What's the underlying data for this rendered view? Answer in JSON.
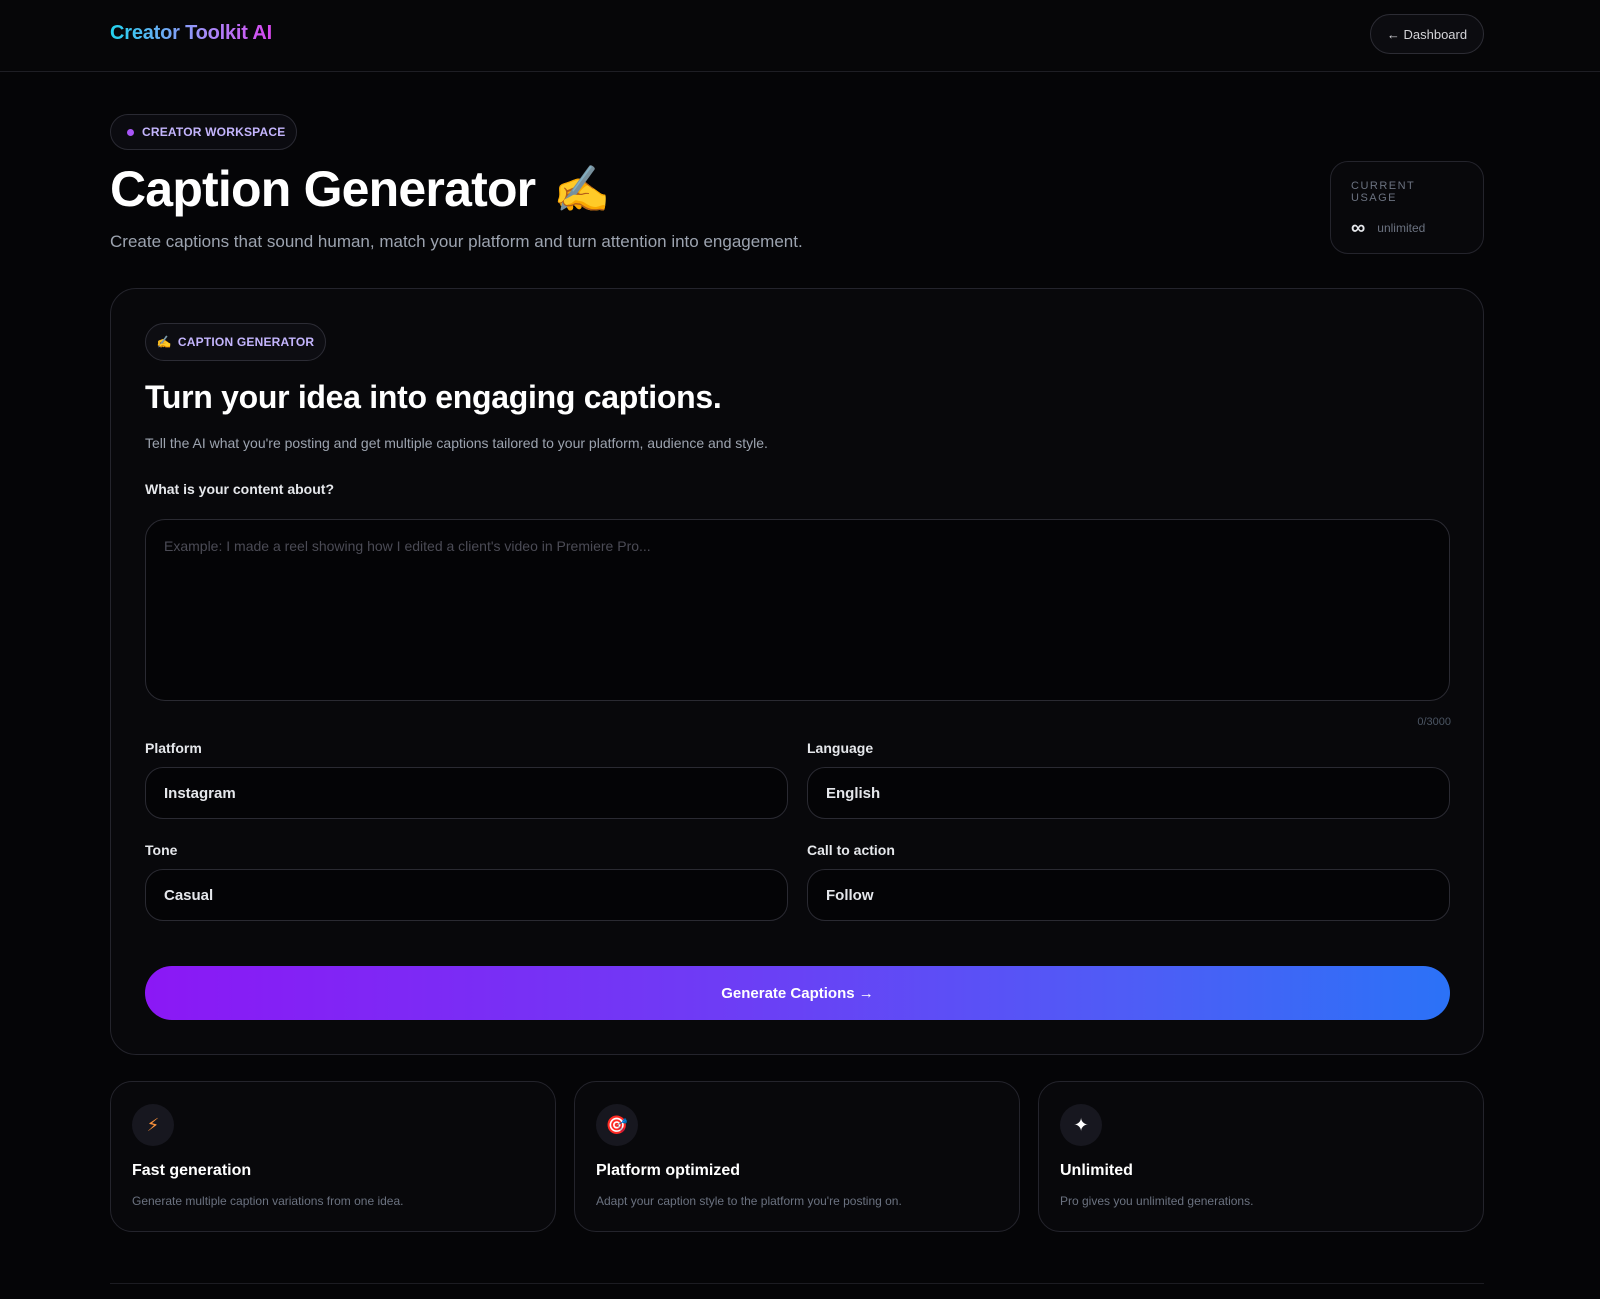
{
  "header": {
    "brand": "Creator Toolkit AI",
    "dashboard_button": "← Dashboard"
  },
  "hero": {
    "badge": "CREATOR WORKSPACE",
    "title": "Caption Generator",
    "title_emoji": "✍️",
    "subtitle": "Create captions that sound human, match your platform and turn attention into engagement."
  },
  "usage": {
    "label": "CURRENT USAGE",
    "icon": "∞",
    "value": "unlimited"
  },
  "card": {
    "badge_emoji": "✍️",
    "badge": "CAPTION GENERATOR",
    "title": "Turn your idea into engaging captions.",
    "subtitle": "Tell the AI what you're posting and get multiple captions tailored to your platform, audience and style.",
    "content_label": "What is your content about?",
    "content_value": "",
    "content_placeholder": "Example: I made a reel showing how I edited a client's video in Premiere Pro...",
    "counter": "0/3000",
    "platform_label": "Platform",
    "platform_value": "Instagram",
    "language_label": "Language",
    "language_value": "English",
    "tone_label": "Tone",
    "tone_value": "Casual",
    "cta_label": "Call to action",
    "cta_value": "Follow",
    "generate_button": "Generate Captions →"
  },
  "features": [
    {
      "icon": "⚡",
      "icon_name": "lightning-icon",
      "title": "Fast generation",
      "description": "Generate multiple caption variations from one idea."
    },
    {
      "icon": "🎯",
      "icon_name": "target-icon",
      "title": "Platform optimized",
      "description": "Adapt your caption style to the platform you're posting on."
    },
    {
      "icon": "✦",
      "icon_name": "sparkle-icon",
      "title": "Unlimited",
      "description": "Pro gives you unlimited generations."
    }
  ],
  "colors": {
    "background": "#050507",
    "accent_purple": "#8b18f5",
    "accent_blue": "#2b72f7",
    "brand_cyan": "#22d3ee"
  }
}
